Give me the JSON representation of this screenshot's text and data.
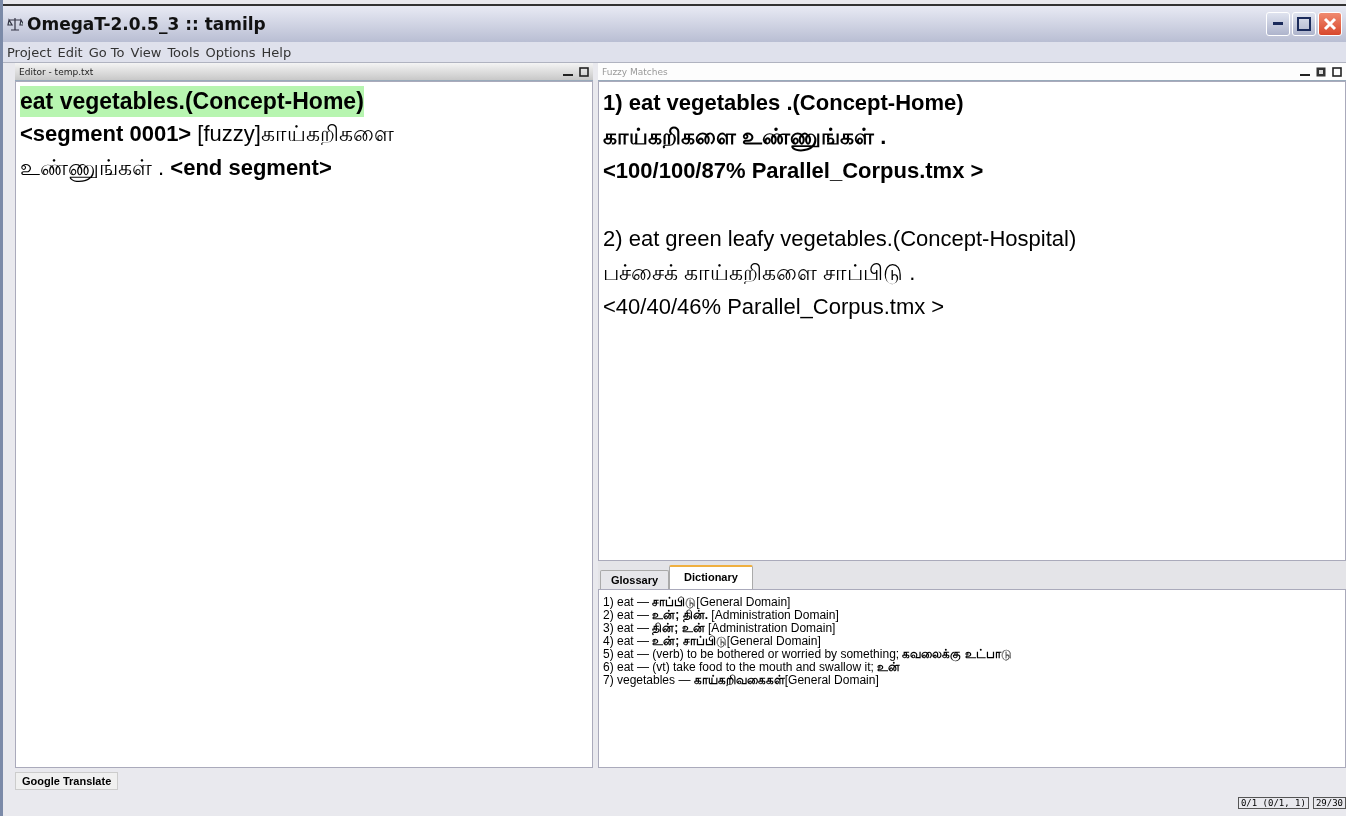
{
  "window": {
    "title": "OmegaT-2.0.5_3 :: tamilp"
  },
  "menu": [
    "Project",
    "Edit",
    "Go To",
    "View",
    "Tools",
    "Options",
    "Help"
  ],
  "editor": {
    "title": "Editor - temp.txt",
    "source": {
      "text": "eat vegetables.(Concept-Home)",
      "selected": true
    },
    "target": "**<segment 0001>** [fuzzy]காய்கறிகளை உண்ணுங்கள் . **<end segment>**"
  },
  "fuzzy_matches": {
    "title": "Fuzzy Matches",
    "matches": [
      {
        "source": "1) eat vegetables .(Concept-Home)",
        "target": "காய்கறிகளை உண்ணுங்கள் .",
        "info": "<100/100/87% Parallel_Corpus.tmx >",
        "selected": true
      },
      {
        "source": "2)  eat green leafy vegetables.(Concept-Hospital)",
        "target": " பச்சைக் காய்கறிகளை சாப்பிடு .",
        "info": "<40/40/46% Parallel_Corpus.tmx >",
        "selected": false
      }
    ]
  },
  "lower_tabs": [
    {
      "label": "Glossary",
      "selected": false
    },
    {
      "label": "Dictionary",
      "selected": true
    }
  ],
  "dictionary": [
    "1) eat — **சாப்பிடு**[General Domain]",
    "2) eat — **உன்; தின்.** [Administration Domain]",
    "3) eat — **தின்; உன்** [Administration Domain]",
    "4) eat — **உன்; சாப்பிடு**[General Domain]",
    "5) eat — (verb) to be bothered or worried by something; **கவலைக்கு உட்பாடு**",
    "6) eat — (vt) take food to the mouth and swallow it; **உன்**",
    "7) vegetables — **காய்கறிவகைகள்**[General Domain]"
  ],
  "bottom_tab": {
    "label": "Google Translate"
  },
  "status": [
    "0/1 (0/1, 1)",
    "29/30"
  ]
}
